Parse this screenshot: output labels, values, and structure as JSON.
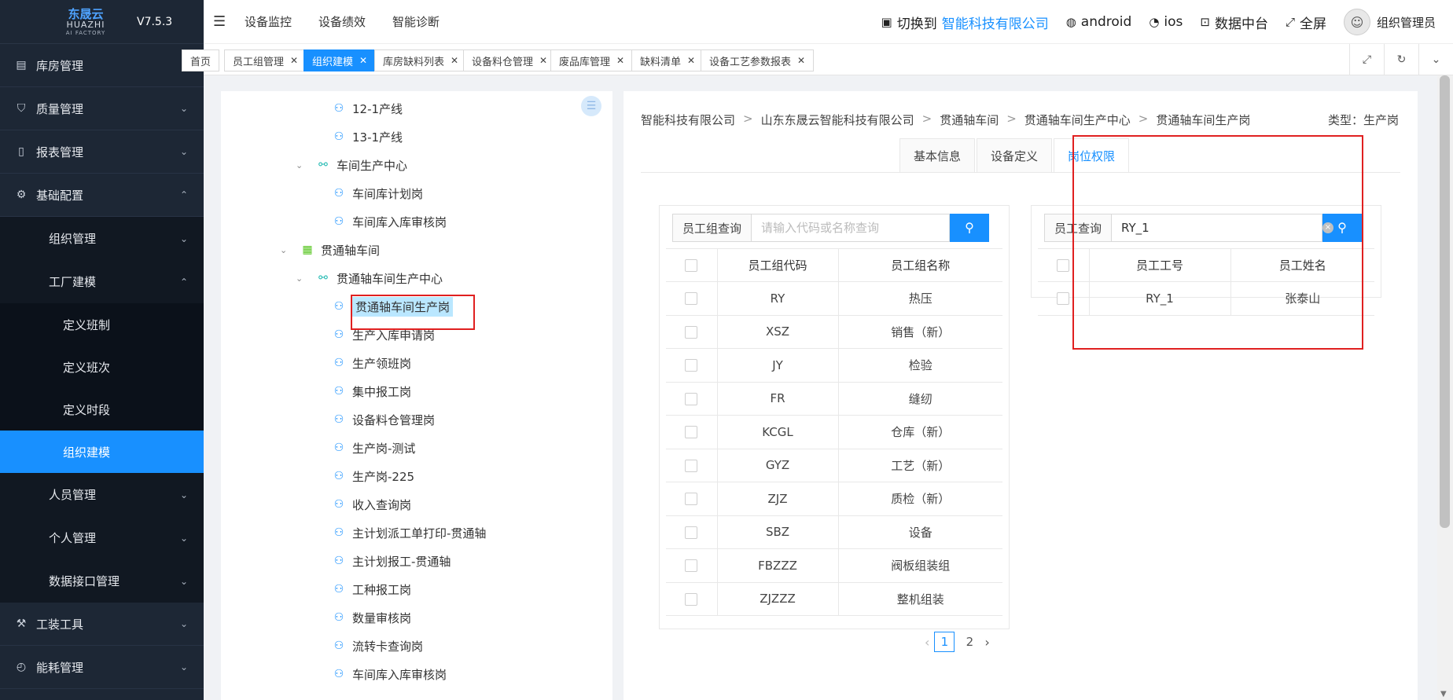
{
  "app": {
    "logo_cn": "东晟云",
    "logo_en": "HUAZHI",
    "logo_sub": "AI FACTORY",
    "version": "V7.5.3"
  },
  "sidebar": {
    "items": [
      {
        "label": "库房管理",
        "icon": "warehouse-icon",
        "level": 1
      },
      {
        "label": "质量管理",
        "icon": "shield-check-icon",
        "level": 1
      },
      {
        "label": "报表管理",
        "icon": "book-icon",
        "level": 1
      },
      {
        "label": "基础配置",
        "icon": "gear-icon",
        "level": 1,
        "expanded": true
      },
      {
        "label": "组织管理",
        "level": 2
      },
      {
        "label": "工厂建模",
        "level": 2,
        "expanded": true
      },
      {
        "label": "定义班制",
        "level": 3
      },
      {
        "label": "定义班次",
        "level": 3
      },
      {
        "label": "定义时段",
        "level": 3
      },
      {
        "label": "组织建模",
        "level": 3,
        "active": true
      },
      {
        "label": "人员管理",
        "level": 2
      },
      {
        "label": "个人管理",
        "level": 2
      },
      {
        "label": "数据接口管理",
        "level": 2
      },
      {
        "label": "工装工具",
        "icon": "wrench-icon",
        "level": 1
      },
      {
        "label": "能耗管理",
        "icon": "gauge-icon",
        "level": 1
      }
    ]
  },
  "header": {
    "nav": [
      "设备监控",
      "设备绩效",
      "智能诊断"
    ],
    "switch_label": "切换到",
    "company": "智能科技有限公司",
    "android": "android",
    "ios": "ios",
    "datacenter": "数据中台",
    "fullscreen": "全屏",
    "user": "组织管理员"
  },
  "tabs": [
    {
      "label": "首页",
      "closable": false
    },
    {
      "label": "员工组管理",
      "closable": true
    },
    {
      "label": "组织建模",
      "closable": true,
      "active": true
    },
    {
      "label": "库房缺料列表",
      "closable": true
    },
    {
      "label": "设备料仓管理",
      "closable": true
    },
    {
      "label": "废品库管理",
      "closable": true
    },
    {
      "label": "缺料清单",
      "closable": true
    },
    {
      "label": "设备工艺参数报表",
      "closable": true
    }
  ],
  "tree": [
    {
      "label": "12-1产线",
      "type": "post"
    },
    {
      "label": "13-1产线",
      "type": "post"
    },
    {
      "label": "车间生产中心",
      "type": "org",
      "caret": "v"
    },
    {
      "label": "车间库计划岗",
      "type": "post"
    },
    {
      "label": "车间库入库审核岗",
      "type": "post"
    },
    {
      "label": "贯通轴车间",
      "type": "ws",
      "caret": "v"
    },
    {
      "label": "贯通轴车间生产中心",
      "type": "org",
      "caret": "v"
    },
    {
      "label": "贯通轴车间生产岗",
      "type": "post",
      "selected": true
    },
    {
      "label": "生产入库申请岗",
      "type": "post"
    },
    {
      "label": "生产领班岗",
      "type": "post"
    },
    {
      "label": "集中报工岗",
      "type": "post"
    },
    {
      "label": "设备料仓管理岗",
      "type": "post"
    },
    {
      "label": "生产岗-测试",
      "type": "post"
    },
    {
      "label": "生产岗-225",
      "type": "post"
    },
    {
      "label": "收入查询岗",
      "type": "post"
    },
    {
      "label": "主计划派工单打印-贯通轴",
      "type": "post"
    },
    {
      "label": "主计划报工-贯通轴",
      "type": "post"
    },
    {
      "label": "工种报工岗",
      "type": "post"
    },
    {
      "label": "数量审核岗",
      "type": "post"
    },
    {
      "label": "流转卡查询岗",
      "type": "post"
    },
    {
      "label": "车间库入库审核岗",
      "type": "post"
    }
  ],
  "detail": {
    "breadcrumb": [
      "智能科技有限公司",
      "山东东晟云智能科技有限公司",
      "贯通轴车间",
      "贯通轴车间生产中心",
      "贯通轴车间生产岗"
    ],
    "breadcrumb_sep": ">",
    "type_label": "类型：生产岗",
    "tabs": [
      "基本信息",
      "设备定义",
      "岗位权限"
    ],
    "active_tab": 2
  },
  "group_panel": {
    "search_label": "员工组查询",
    "search_placeholder": "请输入代码或名称查询",
    "columns": [
      "员工组代码",
      "员工组名称"
    ],
    "rows": [
      [
        "RY",
        "热压"
      ],
      [
        "XSZ",
        "销售（新）"
      ],
      [
        "JY",
        "检验"
      ],
      [
        "FR",
        "缝纫"
      ],
      [
        "KCGL",
        "仓库（新）"
      ],
      [
        "GYZ",
        "工艺（新）"
      ],
      [
        "ZJZ",
        "质检（新）"
      ],
      [
        "SBZ",
        "设备"
      ],
      [
        "FBZZZ",
        "阀板组装组"
      ],
      [
        "ZJZZZ",
        "整机组装"
      ]
    ],
    "pager": {
      "current": "1",
      "next": "2"
    }
  },
  "employee_panel": {
    "search_label": "员工查询",
    "search_value": "RY_1",
    "columns": [
      "员工工号",
      "员工姓名"
    ],
    "rows": [
      [
        "RY_1",
        "张泰山"
      ]
    ]
  },
  "colors": {
    "sidebar_bg": "#1d2735",
    "accent": "#1890ff",
    "highlight_box": "#e02020"
  }
}
